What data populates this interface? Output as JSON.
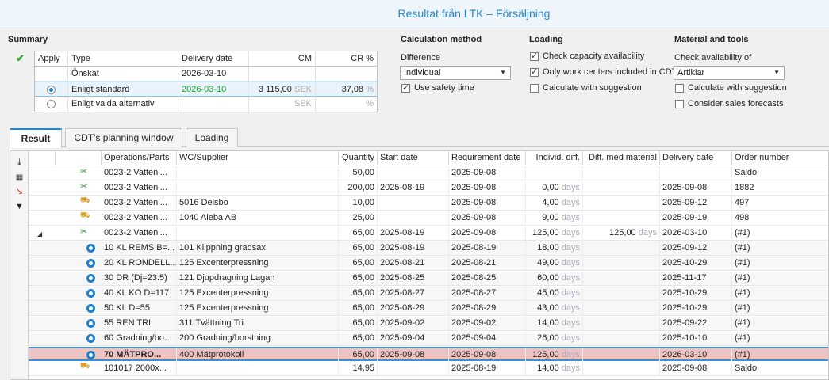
{
  "window": {
    "title": "Resultat från LTK – Försäljning"
  },
  "summary": {
    "title": "Summary",
    "headers": {
      "apply": "Apply",
      "type": "Type",
      "delivery": "Delivery date",
      "cm": "CM",
      "cr": "CR %"
    },
    "rows": [
      {
        "type": "Önskat",
        "delivery": "2026-03-10",
        "cm": "",
        "cm_unit": "",
        "cr": "",
        "cr_unit": ""
      },
      {
        "type": "Enligt standard",
        "delivery": "2026-03-10",
        "cm": "3 115,00",
        "cm_unit": "SEK",
        "cr": "37,08",
        "cr_unit": "%"
      },
      {
        "type": "Enligt valda alternativ",
        "delivery": "",
        "cm": "",
        "cm_unit": "SEK",
        "cr": "",
        "cr_unit": "%"
      }
    ]
  },
  "calc": {
    "title": "Calculation method",
    "difference_label": "Difference",
    "difference_value": "Individual",
    "safety_time": "Use safety time"
  },
  "loading": {
    "title": "Loading",
    "check_capacity": "Check capacity availability",
    "only_wc": "Only work centers included in CDT",
    "calc_suggestion": "Calculate with suggestion"
  },
  "material": {
    "title": "Material and tools",
    "check_label": "Check availability of",
    "check_value": "Artiklar",
    "calc_suggestion": "Calculate with suggestion",
    "forecasts": "Consider sales forecasts"
  },
  "tabs": [
    "Result",
    "CDT's planning window",
    "Loading"
  ],
  "grid": {
    "headers": [
      "Operations/Parts",
      "WC/Supplier",
      "Quantity",
      "Start date",
      "Requirement date",
      "Individ. diff.",
      "Diff. med material",
      "Delivery date",
      "Order number"
    ],
    "days_unit": "days",
    "rows": [
      {
        "icon": "scissor",
        "op": "0023-2  Vattenl...",
        "wc": "",
        "qty": "50,00",
        "start": "",
        "req": "2025-09-08",
        "diff": "",
        "diffmat": "",
        "delivery": "",
        "order": "Saldo"
      },
      {
        "icon": "scissor",
        "op": "0023-2  Vattenl...",
        "wc": "",
        "qty": "200,00",
        "start": "2025-08-19",
        "req": "2025-09-08",
        "diff": "0,00",
        "diffmat": "",
        "delivery": "2025-09-08",
        "order": "1882"
      },
      {
        "icon": "cart",
        "op": "0023-2  Vattenl...",
        "wc": "5016   Delsbo",
        "qty": "10,00",
        "start": "",
        "req": "2025-09-08",
        "diff": "4,00",
        "diffmat": "",
        "delivery": "2025-09-12",
        "order": "497"
      },
      {
        "icon": "cart",
        "op": "0023-2  Vattenl...",
        "wc": "1040   Aleba AB",
        "qty": "25,00",
        "start": "",
        "req": "2025-09-08",
        "diff": "9,00",
        "diffmat": "",
        "delivery": "2025-09-19",
        "order": "498"
      },
      {
        "icon": "scissor",
        "expand": "◢",
        "op": "0023-2  Vattenl...",
        "wc": "",
        "qty": "65,00",
        "start": "2025-08-19",
        "req": "2025-09-08",
        "diff": "125,00",
        "diffmat": "125,00",
        "delivery": "2026-03-10",
        "order": "(#1)"
      },
      {
        "icon": "gear",
        "child": true,
        "op": "10   KL REMS B=...",
        "wc": "101   Klippning gradsax",
        "qty": "65,00",
        "start": "2025-08-19",
        "req": "2025-08-19",
        "diff": "18,00",
        "diffmat": "",
        "delivery": "2025-09-12",
        "order": "(#1)"
      },
      {
        "icon": "gear",
        "child": true,
        "op": "20   KL RONDELL...",
        "wc": "125   Excenterpressning",
        "qty": "65,00",
        "start": "2025-08-21",
        "req": "2025-08-21",
        "diff": "49,00",
        "diffmat": "",
        "delivery": "2025-10-29",
        "order": "(#1)"
      },
      {
        "icon": "gear",
        "child": true,
        "op": "30   DR (Dj=23.5)",
        "wc": "121   Djupdragning Lagan",
        "qty": "65,00",
        "start": "2025-08-25",
        "req": "2025-08-25",
        "diff": "60,00",
        "diffmat": "",
        "delivery": "2025-11-17",
        "order": "(#1)"
      },
      {
        "icon": "gear",
        "child": true,
        "op": "40   KL KO D=117",
        "wc": "125   Excenterpressning",
        "qty": "65,00",
        "start": "2025-08-27",
        "req": "2025-08-27",
        "diff": "45,00",
        "diffmat": "",
        "delivery": "2025-10-29",
        "order": "(#1)"
      },
      {
        "icon": "gear",
        "child": true,
        "op": "50   KL D=55",
        "wc": "125   Excenterpressning",
        "qty": "65,00",
        "start": "2025-08-29",
        "req": "2025-08-29",
        "diff": "43,00",
        "diffmat": "",
        "delivery": "2025-10-29",
        "order": "(#1)"
      },
      {
        "icon": "gear",
        "child": true,
        "op": "55   REN TRI",
        "wc": "311   Tvättning Tri",
        "qty": "65,00",
        "start": "2025-09-02",
        "req": "2025-09-02",
        "diff": "14,00",
        "diffmat": "",
        "delivery": "2025-09-22",
        "order": "(#1)"
      },
      {
        "icon": "gear",
        "child": true,
        "op": "60   Gradning/bo...",
        "wc": "200   Gradning/borstning",
        "qty": "65,00",
        "start": "2025-09-04",
        "req": "2025-09-04",
        "diff": "26,00",
        "diffmat": "",
        "delivery": "2025-10-10",
        "order": "(#1)"
      },
      {
        "icon": "gear",
        "child": true,
        "hl": true,
        "op": "70   MÄTPRO...",
        "wc": "400   Mätprotokoll",
        "qty": "65,00",
        "start": "2025-09-08",
        "req": "2025-09-08",
        "diff": "125,00",
        "diffmat": "",
        "delivery": "2026-03-10",
        "order": "(#1)"
      },
      {
        "icon": "cart",
        "op": "101017  2000x...",
        "wc": "",
        "qty": "14,95",
        "start": "",
        "req": "2025-08-19",
        "diff": "14,00",
        "diffmat": "",
        "delivery": "2025-09-08",
        "order": "Saldo"
      }
    ]
  }
}
